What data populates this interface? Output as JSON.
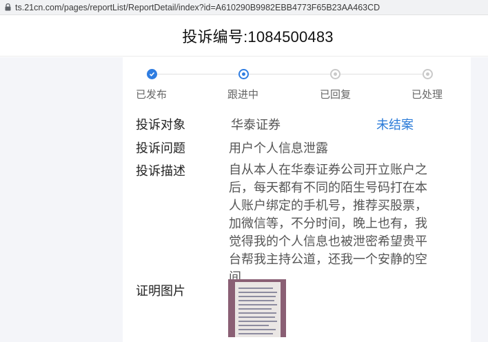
{
  "browser": {
    "url": "ts.21cn.com/pages/reportList/ReportDetail/index?id=A610290B9982EBB4773F65B23AA463CD"
  },
  "header": {
    "title": "投诉编号:1084500483"
  },
  "progress": {
    "steps": [
      {
        "label": "已发布",
        "state": "done"
      },
      {
        "label": "跟进中",
        "state": "current"
      },
      {
        "label": "已回复",
        "state": "pending"
      },
      {
        "label": "已处理",
        "state": "pending"
      }
    ]
  },
  "details": {
    "target_label": "投诉对象",
    "target_value": "华泰证券",
    "status": "未结案",
    "issue_label": "投诉问题",
    "issue_value": "用户个人信息泄露",
    "description_label": "投诉描述",
    "description_lines": [
      "自从本人在华泰证券公司开立账户之",
      "后，每天都有不同的陌生号码打在本",
      "人账户绑定的手机号，推荐买股票，",
      "加微信等，不分时间，晚上也有，我",
      "觉得我的个人信息也被泄密希望贵平",
      "台帮我主持公道，还我一个安静的空",
      "间"
    ],
    "proof_label": "证明图片"
  },
  "colors": {
    "accent": "#2f7de1",
    "status": "#2b7bd8",
    "pending": "#c9c9c9"
  }
}
